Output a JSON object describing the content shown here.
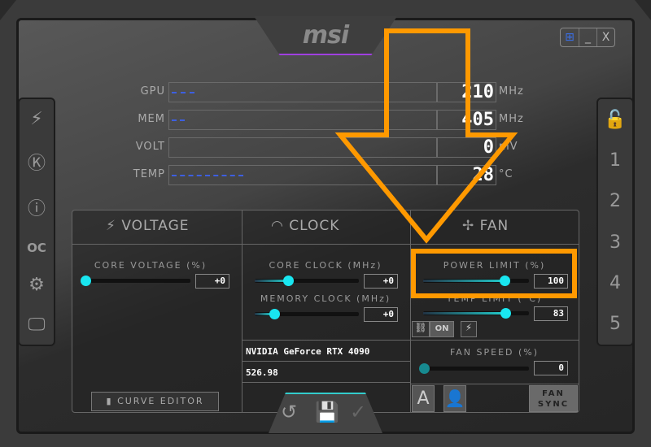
{
  "brand": "msi",
  "window_buttons": {
    "windows": "⊞",
    "minimize": "_",
    "close": "X"
  },
  "left_sidebar": [
    {
      "icon": "kombustor-icon",
      "glyph": "⚡"
    },
    {
      "icon": "k-boost-icon",
      "glyph": "Ⓚ"
    },
    {
      "icon": "info-icon",
      "glyph": "ⓘ"
    },
    {
      "icon": "oc-scanner-icon",
      "glyph": "OC"
    },
    {
      "icon": "settings-gear-icon",
      "glyph": "⚙"
    },
    {
      "icon": "monitor-icon",
      "glyph": "🖵"
    }
  ],
  "right_sidebar": {
    "lock_glyph": "🔓",
    "profiles": [
      "1",
      "2",
      "3",
      "4",
      "5"
    ]
  },
  "monitor": [
    {
      "label": "GPU",
      "value": "210",
      "unit": "MHz"
    },
    {
      "label": "MEM",
      "value": "405",
      "unit": "MHz"
    },
    {
      "label": "VOLT",
      "value": "0",
      "unit": "mV"
    },
    {
      "label": "TEMP",
      "value": "28",
      "unit": "°C"
    }
  ],
  "voltage": {
    "title": "VOLTAGE",
    "core_voltage_label": "CORE VOLTAGE  (%)",
    "core_voltage_value": "+0",
    "curve_editor": "CURVE EDITOR"
  },
  "clock": {
    "title": "CLOCK",
    "core_clock_label": "CORE CLOCK (MHz)",
    "core_clock_value": "+0",
    "memory_clock_label": "MEMORY CLOCK (MHz)",
    "memory_clock_value": "+0",
    "gpu_name": "NVIDIA GeForce RTX 4090",
    "driver": "526.98"
  },
  "fan": {
    "title": "FAN",
    "power_limit_label": "POWER LIMIT (%)",
    "power_limit_value": "100",
    "power_limit_level": 0.77,
    "temp_limit_label": "TEMP LIMIT (°C)",
    "temp_limit_value": "83",
    "temp_limit_level": 0.78,
    "link_on": "ON",
    "fan_speed_label": "FAN SPEED (%)",
    "fan_speed_value": "0",
    "auto": "A",
    "fan_sync": "FAN SYNC"
  },
  "overlay_color": "#ff9900"
}
